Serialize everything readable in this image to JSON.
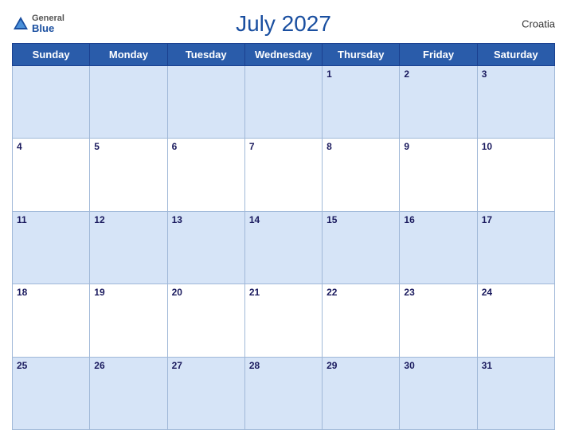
{
  "header": {
    "title": "July 2027",
    "country": "Croatia",
    "logo": {
      "general": "General",
      "blue": "Blue"
    }
  },
  "days_of_week": [
    "Sunday",
    "Monday",
    "Tuesday",
    "Wednesday",
    "Thursday",
    "Friday",
    "Saturday"
  ],
  "weeks": [
    [
      null,
      null,
      null,
      null,
      1,
      2,
      3
    ],
    [
      4,
      5,
      6,
      7,
      8,
      9,
      10
    ],
    [
      11,
      12,
      13,
      14,
      15,
      16,
      17
    ],
    [
      18,
      19,
      20,
      21,
      22,
      23,
      24
    ],
    [
      25,
      26,
      27,
      28,
      29,
      30,
      31
    ]
  ]
}
